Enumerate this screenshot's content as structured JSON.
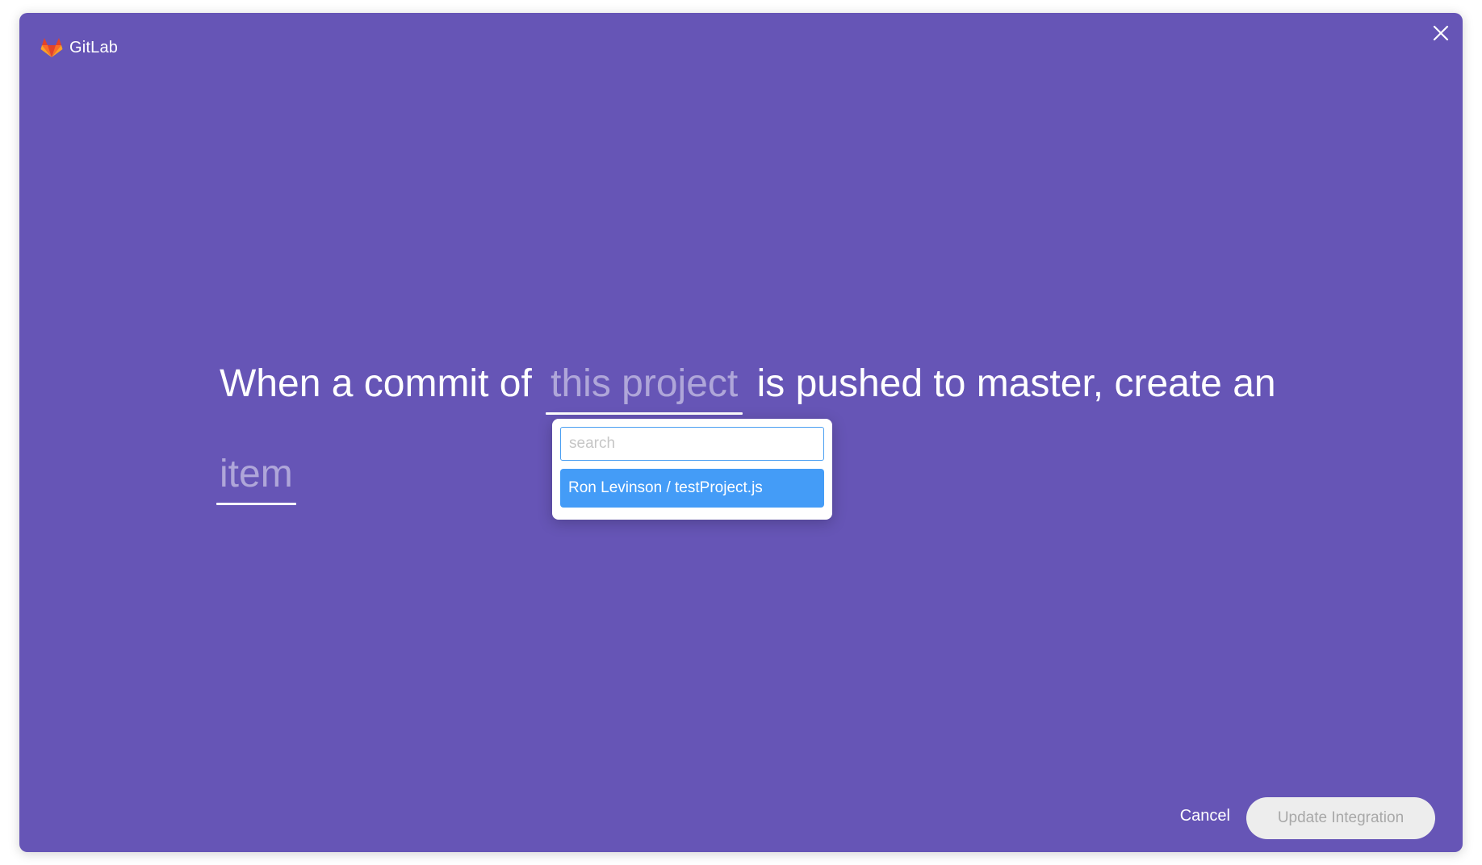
{
  "brand": {
    "name": "GitLab",
    "logo_icon": "gitlab-tanuki-icon",
    "logo_colors": [
      "#e24329",
      "#fc6d26",
      "#fca326"
    ]
  },
  "close_icon": "close-icon",
  "recipe": {
    "line1_prefix": "When a commit of",
    "project_placeholder": "this project",
    "line1_suffix": "is pushed to master, create an",
    "item_placeholder": "item"
  },
  "dropdown": {
    "search_placeholder": "search",
    "options": [
      {
        "label": "Ron Levinson / testProject.js",
        "highlighted": true
      }
    ]
  },
  "footer": {
    "cancel_label": "Cancel",
    "update_label": "Update Integration",
    "update_enabled": false
  },
  "colors": {
    "background": "#6655b6",
    "option_highlight": "#449cf7",
    "input_focus_border": "#4a9ff2",
    "disabled_button_bg": "#ededed"
  }
}
